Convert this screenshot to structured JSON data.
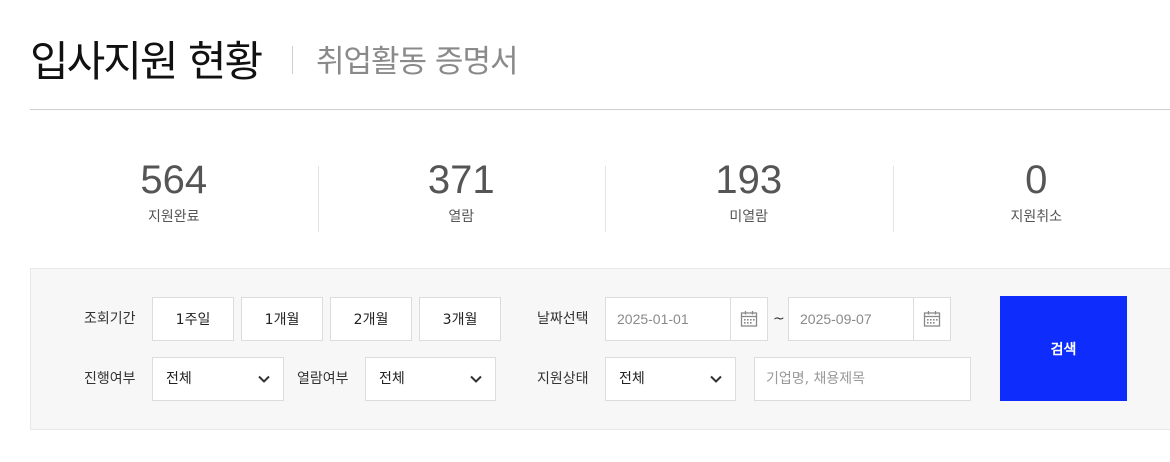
{
  "header": {
    "title": "입사지원 현황",
    "sub_link": "취업활동 증명서"
  },
  "stats": [
    {
      "value": "564",
      "label": "지원완료"
    },
    {
      "value": "371",
      "label": "열람"
    },
    {
      "value": "193",
      "label": "미열람"
    },
    {
      "value": "0",
      "label": "지원취소"
    }
  ],
  "filter": {
    "period_label": "조회기간",
    "periods": [
      "1주일",
      "1개월",
      "2개월",
      "3개월"
    ],
    "date_label": "날짜선택",
    "date_from": "2025-01-01",
    "date_sep": "~",
    "date_to": "2025-09-07",
    "progress_label": "진행여부",
    "progress_value": "전체",
    "read_label": "열람여부",
    "read_value": "전체",
    "status_label": "지원상태",
    "status_value": "전체",
    "keyword_placeholder": "기업명, 채용제목",
    "search_label": "검색"
  },
  "colors": {
    "accent": "#0e2dfc",
    "panel_bg": "#f7f7f7",
    "border": "#dcdcdc"
  },
  "icons": [
    "calendar-icon",
    "chevron-down-icon"
  ]
}
